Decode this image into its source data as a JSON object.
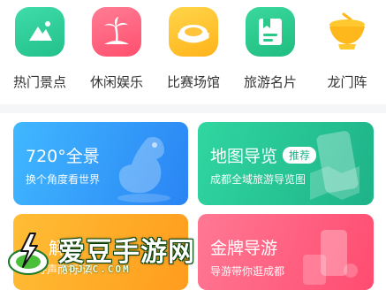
{
  "icons": [
    {
      "label": "热门景点",
      "icon": "mountain-icon",
      "color": "#2cc996"
    },
    {
      "label": "休闲娱乐",
      "icon": "palm-island-icon",
      "color": "#ff5c7a"
    },
    {
      "label": "比赛场馆",
      "icon": "stadium-icon",
      "color": "#ffbf1f"
    },
    {
      "label": "旅游名片",
      "icon": "card-bookmark-icon",
      "color": "#25c889"
    },
    {
      "label": "龙门阵",
      "icon": "teacup-icon",
      "color": "#ffc02a"
    }
  ],
  "cards": {
    "panorama": {
      "title": "720°全景",
      "subtitle": "换个角度看世界",
      "color_from": "#3bb3ff",
      "color_to": "#2a82f5"
    },
    "map_guide": {
      "title": "地图导览",
      "badge": "推荐",
      "subtitle": "成都全域旅游导览图",
      "color_from": "#2fd39a",
      "color_to": "#1fb38a"
    },
    "explain": {
      "title": "解",
      "subtitle": "寻声而行·识",
      "color_from": "#ffb52e",
      "color_to": "#ff9a1f"
    },
    "gold_guide": {
      "title": "金牌导游",
      "subtitle": "导游带你逛成都",
      "color_from": "#ff6f8e",
      "color_to": "#ff4d70"
    }
  },
  "watermark": {
    "name": "爱豆手游网",
    "url": "ADJZC.COM"
  }
}
